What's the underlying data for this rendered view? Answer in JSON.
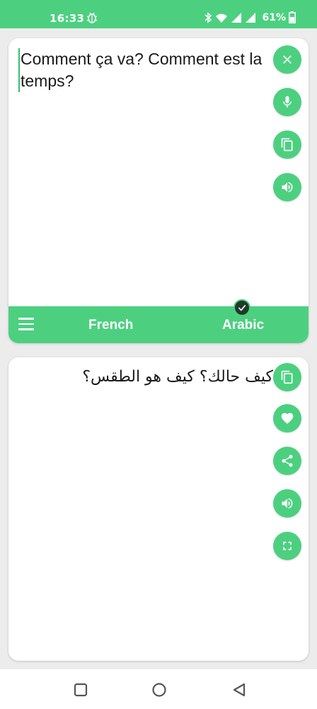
{
  "status_bar": {
    "time": "16:33",
    "battery": "61%"
  },
  "input_card": {
    "text": "Comment ça va? Comment est la temps?",
    "buttons": [
      "close-icon",
      "microphone-icon",
      "copy-icon",
      "speaker-icon"
    ]
  },
  "language_bar": {
    "source": "French",
    "target": "Arabic"
  },
  "output_card": {
    "text": "كيف حالك؟ كيف هو الطقس؟",
    "buttons": [
      "copy-icon",
      "heart-icon",
      "share-icon",
      "speaker-icon",
      "fullscreen-icon"
    ]
  },
  "colors": {
    "accent": "#4cd080",
    "badge": "#1e3b2a",
    "background": "#ececec"
  }
}
